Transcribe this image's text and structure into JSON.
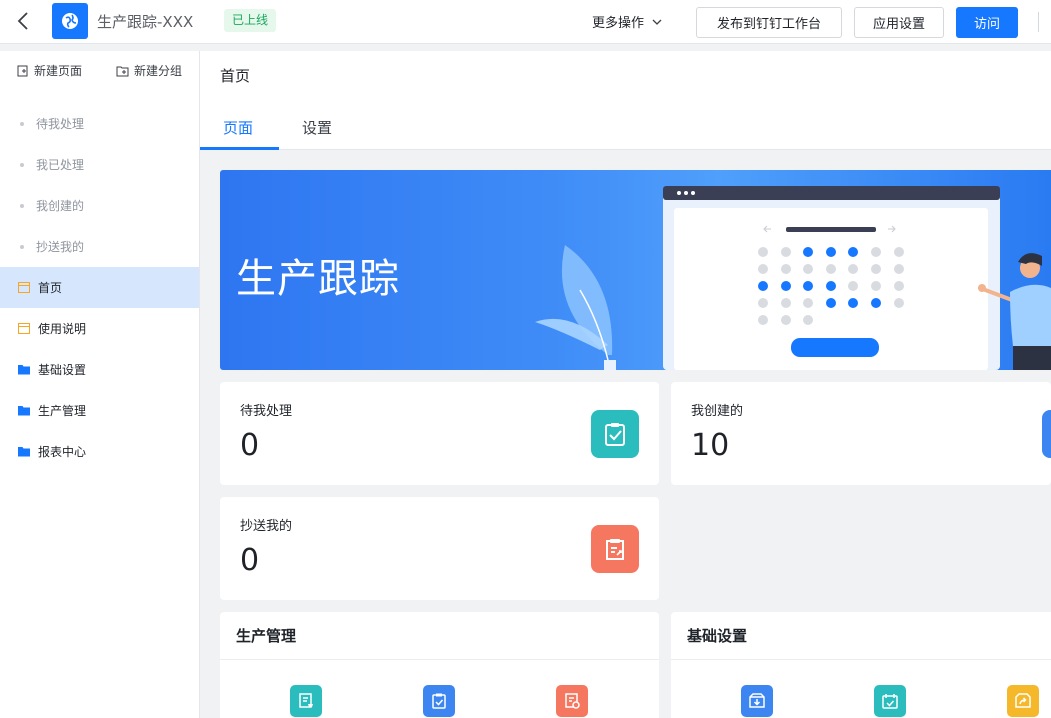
{
  "topbar": {
    "app_title": "生产跟踪-XXX",
    "status_badge": "已上线",
    "more_actions": "更多操作",
    "publish_button": "发布到钉钉工作台",
    "settings_button": "应用设置",
    "visit_button": "访问"
  },
  "sidebar": {
    "new_page": "新建页面",
    "new_group": "新建分组",
    "items": [
      {
        "label": "待我处理",
        "type": "sub"
      },
      {
        "label": "我已处理",
        "type": "sub"
      },
      {
        "label": "我创建的",
        "type": "sub"
      },
      {
        "label": "抄送我的",
        "type": "sub"
      },
      {
        "label": "首页",
        "type": "page",
        "active": true
      },
      {
        "label": "使用说明",
        "type": "page"
      },
      {
        "label": "基础设置",
        "type": "folder"
      },
      {
        "label": "生产管理",
        "type": "folder"
      },
      {
        "label": "报表中心",
        "type": "folder"
      }
    ]
  },
  "main": {
    "breadcrumb": "首页",
    "tabs": [
      {
        "label": "页面",
        "active": true
      },
      {
        "label": "设置",
        "active": false
      }
    ],
    "banner_title": "生产跟踪",
    "stats": [
      {
        "label": "待我处理",
        "value": "0",
        "icon": "clipboard-check-icon",
        "color": "#2bbdbd"
      },
      {
        "label": "我创建的",
        "value": "10",
        "icon": "document-icon",
        "color": "#3d86f2"
      },
      {
        "label": "抄送我的",
        "value": "0",
        "icon": "clipboard-send-icon",
        "color": "#f6775f"
      }
    ],
    "sections": [
      {
        "title": "生产管理",
        "icons": [
          {
            "name": "form-cart-icon",
            "color": "#2bbdbd"
          },
          {
            "name": "clipboard-check-icon",
            "color": "#3d86f2"
          },
          {
            "name": "form-settings-icon",
            "color": "#f6775f"
          }
        ]
      },
      {
        "title": "基础设置",
        "icons": [
          {
            "name": "inbox-download-icon",
            "color": "#3d86f2"
          },
          {
            "name": "calendar-check-icon",
            "color": "#2bbdbd"
          },
          {
            "name": "box-share-icon",
            "color": "#f5b82b"
          }
        ]
      }
    ]
  },
  "colors": {
    "brand": "#1677ff",
    "active_bg": "#d6e7fd",
    "page_icon": "#f5a623",
    "folder_icon": "#1677ff"
  }
}
